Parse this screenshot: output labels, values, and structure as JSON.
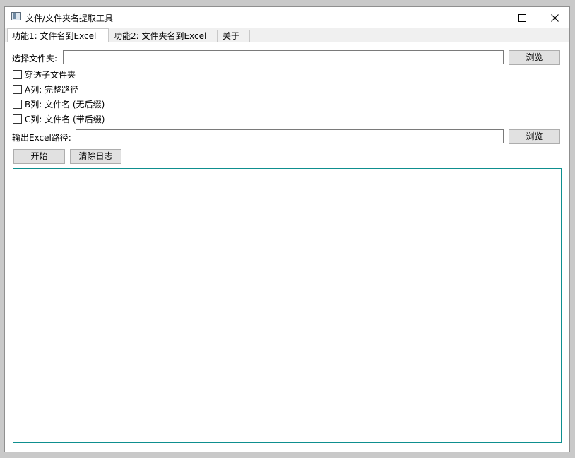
{
  "window": {
    "title": "文件/文件夹名提取工具"
  },
  "tabs": [
    {
      "label": "功能1: 文件名到Excel",
      "active": true
    },
    {
      "label": "功能2: 文件夹名到Excel",
      "active": false
    },
    {
      "label": "关于",
      "active": false
    }
  ],
  "folder": {
    "label": "选择文件夹:",
    "value": "",
    "browse_label": "浏览"
  },
  "options": [
    {
      "label": "穿透子文件夹",
      "checked": false
    },
    {
      "label": "A列: 完整路径",
      "checked": false
    },
    {
      "label": "B列: 文件名 (无后缀)",
      "checked": false
    },
    {
      "label": "C列: 文件名 (带后缀)",
      "checked": false
    }
  ],
  "output": {
    "label": "输出Excel路径:",
    "value": "",
    "browse_label": "浏览"
  },
  "actions": {
    "start_label": "开始",
    "clear_log_label": "清除日志"
  },
  "log": {
    "text": ""
  },
  "colors": {
    "log_border": "#0e8f8f",
    "button_bg": "#e1e1e1"
  },
  "icons": {
    "app": "app-window-icon",
    "minimize": "minimize-icon",
    "maximize": "maximize-icon",
    "close": "close-icon"
  }
}
